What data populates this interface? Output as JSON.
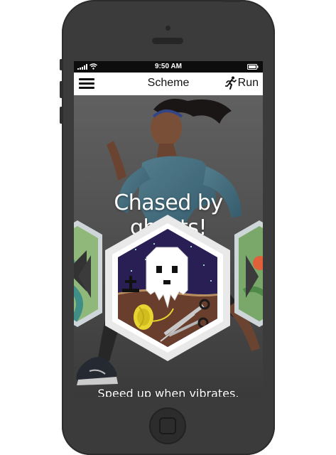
{
  "status_bar": {
    "time": "9:50 AM"
  },
  "nav": {
    "title": "Scheme",
    "run_label": "Run"
  },
  "slide": {
    "title": "Chased by ghosts!",
    "subtitle": "Speed up when vibrates."
  },
  "pager": {
    "count": 4,
    "active_index": 1
  },
  "icons": {
    "menu": "hamburger-menu-icon",
    "run": "running-person-icon",
    "battery": "battery-icon",
    "wifi": "wifi-icon",
    "signal": "signal-bars-icon"
  },
  "colors": {
    "phone_body": "#3b3b3b",
    "nav_bg": "#ffffff",
    "badge_purple": "#3d2b7a",
    "badge_frame": "#e9e9e9",
    "status_bar": "#0d0d0d"
  }
}
